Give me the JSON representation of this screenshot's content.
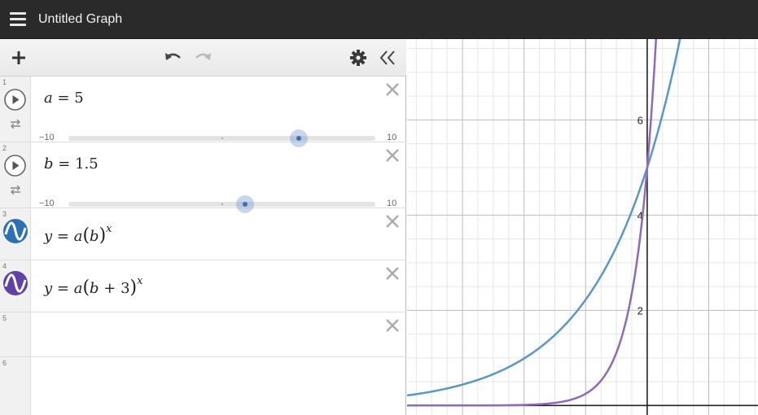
{
  "header": {
    "title": "Untitled Graph"
  },
  "expressions": [
    {
      "index": "1",
      "latex": "a = 5",
      "var": "a",
      "value": "5",
      "slider": {
        "min": "−10",
        "max": "10",
        "min_value": -10,
        "max_value": 10,
        "value": 5
      }
    },
    {
      "index": "2",
      "latex": "b = 1.5",
      "var": "b",
      "value": "1.5",
      "slider": {
        "min": "−10",
        "max": "10",
        "min_value": -10,
        "max_value": 10,
        "value": 1.5
      }
    },
    {
      "index": "3",
      "latex": "y = a(b)^x",
      "color": "#2d70b3"
    },
    {
      "index": "4",
      "latex": "y = a(b+3)^x",
      "color": "#6042a6"
    },
    {
      "index": "5"
    },
    {
      "index": "6"
    }
  ],
  "graph": {
    "x_range": [
      -7.8,
      3.6
    ],
    "y_range": [
      -0.2,
      7.7
    ],
    "y_tick_labels": [
      "2",
      "4",
      "6"
    ],
    "curve_colors": {
      "f1": "#5b97c4",
      "f2": "#8f6ab8"
    }
  }
}
